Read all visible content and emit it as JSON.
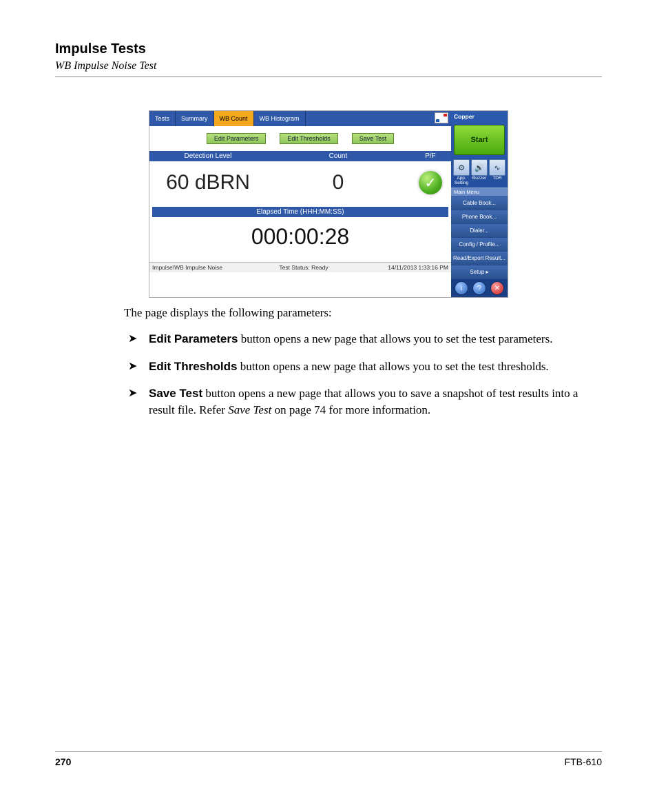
{
  "header": {
    "title": "Impulse Tests",
    "subtitle": "WB Impulse Noise Test"
  },
  "screenshot": {
    "tabs": [
      "Tests",
      "Summary",
      "WB Count",
      "WB Histogram"
    ],
    "active_tab_index": 2,
    "buttons": {
      "edit_parameters": "Edit Parameters",
      "edit_thresholds": "Edit Thresholds",
      "save_test": "Save Test"
    },
    "columns": {
      "detection_level": "Detection Level",
      "count": "Count",
      "pf": "P/F"
    },
    "result": {
      "detection_level_value": "60 dBRN",
      "count_value": "0",
      "pass": true
    },
    "elapsed_label": "Elapsed Time (HHH:MM:SS)",
    "elapsed_value": "000:00:28",
    "statusbar": {
      "left": "Impulse\\WB Impulse Noise",
      "center": "Test Status: Ready",
      "right": "14/11/2013 1:33:16 PM"
    },
    "side": {
      "title": "Copper",
      "start": "Start",
      "icons": [
        "App. Setting",
        "Buzzer",
        "TDR"
      ],
      "main_menu_label": "Main Menu",
      "menu": [
        "Cable Book...",
        "Phone Book...",
        "Dialer...",
        "Config / Profile...",
        "Read/Export Result...",
        "Setup"
      ]
    }
  },
  "body": {
    "intro": "The page displays the following parameters:",
    "items": [
      {
        "bold": "Edit Parameters",
        "rest": " button opens a new page that allows you to set the test parameters."
      },
      {
        "bold": "Edit Thresholds",
        "rest": " button opens a new page that allows you to set the test thresholds."
      },
      {
        "bold": "Save Test",
        "rest_a": " button opens a new page that allows you to save a snapshot of test results into a result file. Refer ",
        "italic": "Save Test",
        "rest_b": " on page 74 for more information."
      }
    ]
  },
  "footer": {
    "page_number": "270",
    "model": "FTB-610"
  }
}
